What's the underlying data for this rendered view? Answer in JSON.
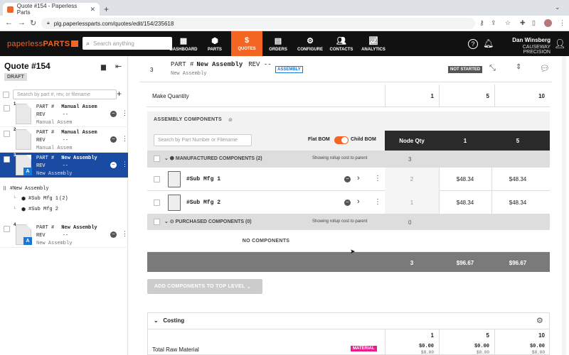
{
  "browser": {
    "tab_title": "Quote #154 - Paperless Parts",
    "url": "plg.paperlessparts.com/quotes/edit/154/235618"
  },
  "header": {
    "logo_light": "paperless",
    "logo_bold": "PARTS",
    "search_placeholder": "Search anything",
    "nav": [
      {
        "label": "DASHBOARD",
        "icon": "grid-icon"
      },
      {
        "label": "PARTS",
        "icon": "cube-icon"
      },
      {
        "label": "QUOTES",
        "icon": "dollar-icon",
        "active": true
      },
      {
        "label": "ORDERS",
        "icon": "clipboard-icon"
      },
      {
        "label": "CONFIGURE",
        "icon": "gears-icon"
      },
      {
        "label": "CONTACTS",
        "icon": "people-icon"
      },
      {
        "label": "ANALYTICS",
        "icon": "chart-icon"
      }
    ],
    "user_name": "Dan Winsberg",
    "company": "CAUSEWAY PRECISION"
  },
  "left": {
    "quote_title": "Quote #154",
    "status": "DRAFT",
    "search_placeholder": "Search by part #, rev, or filename",
    "parts": [
      {
        "num": "1",
        "part_label": "PART #",
        "part": "Manual Assem",
        "rev_label": "REV",
        "rev": "--",
        "sub": "Manual Assem"
      },
      {
        "num": "2",
        "part_label": "PART #",
        "part": "Manual Assem",
        "rev_label": "REV",
        "rev": "--",
        "sub": "Manual Assem"
      },
      {
        "num": "3",
        "part_label": "PART #",
        "part": "New Assembly",
        "rev_label": "REV",
        "rev": "--",
        "sub": "New Assembly",
        "badge": "A"
      },
      {
        "num": "4",
        "part_label": "PART #",
        "part": "New Assembly",
        "rev_label": "REV",
        "rev": "--",
        "sub": "New Assembly",
        "badge": "A"
      }
    ],
    "tree": {
      "root": "#New Assembly",
      "children": [
        {
          "name": "#Sub Mfg 1",
          "qty": "(2)"
        },
        {
          "name": "#Sub Mfg 2",
          "qty": ""
        }
      ]
    }
  },
  "main": {
    "row_num": "3",
    "part_label": "PART #",
    "part": "New Assembly",
    "rev_label": "REV",
    "rev": "--",
    "sub": "New Assembly",
    "type_badge": "ASSEMBLY",
    "status": "NOT STARTED",
    "make_quantity_label": "Make Quantity",
    "make_quantities": [
      "1",
      "5",
      "10"
    ],
    "assembly": {
      "title": "ASSEMBLY COMPONENTS",
      "search_placeholder": "Search by Part Number or Filename",
      "flat_bom": "Flat BOM",
      "child_bom": "Child BOM",
      "col_node_qty": "Node Qty",
      "col_q1": "1",
      "col_q2": "5",
      "manufactured_label": "MANUFACTURED COMPONENTS (2)",
      "manufactured_node_qty": "3",
      "rollup_text": "Showing rollup cost to parent",
      "components": [
        {
          "name": "#Sub Mfg 1",
          "node_qty": "2",
          "q1": "$48.34",
          "q2": "$48.34"
        },
        {
          "name": "#Sub Mfg 2",
          "node_qty": "1",
          "q1": "$48.34",
          "q2": "$48.34"
        }
      ],
      "purchased_label": "PURCHASED COMPONENTS (0)",
      "purchased_node_qty": "0",
      "no_components": "NO COMPONENTS",
      "totals": {
        "node_qty": "3",
        "q1": "$96.67",
        "q2": "$96.67"
      },
      "add_button": "ADD COMPONENTS TO TOP LEVEL"
    },
    "costing": {
      "title": "Costing",
      "quantities": [
        "1",
        "5",
        "10"
      ],
      "row_label": "Total Raw Material",
      "badge": "MATERIAL",
      "values": [
        "$0.00",
        "$0.00",
        "$0.00"
      ],
      "subvalues": [
        "$0.00",
        "$0.00",
        "$0.00"
      ]
    }
  }
}
